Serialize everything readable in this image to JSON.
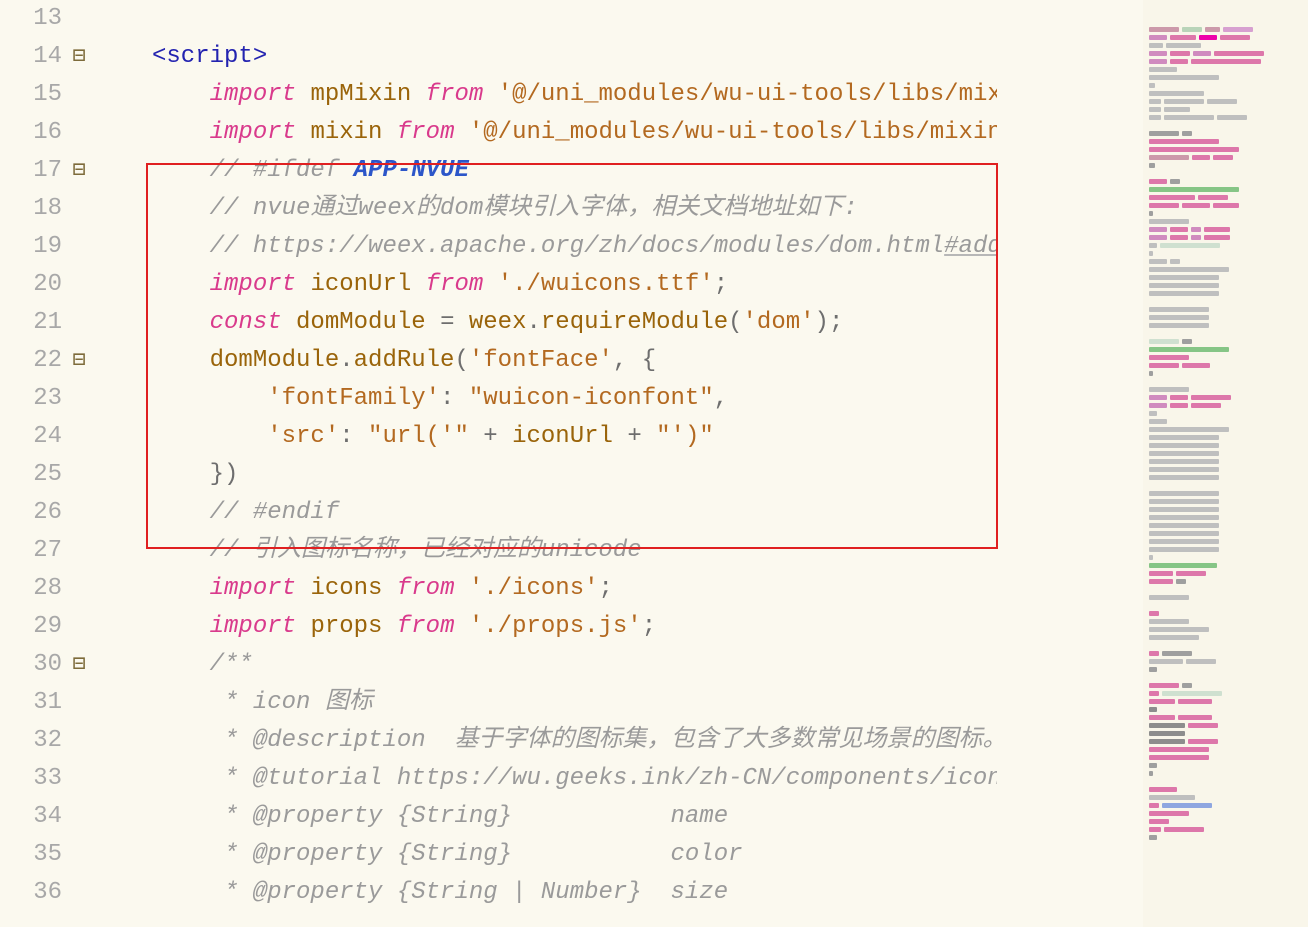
{
  "rows": [
    {
      "n": 13,
      "fold": "",
      "guides": "",
      "html": ""
    },
    {
      "n": 14,
      "fold": "⊟",
      "guides": "",
      "html": "<span class='tag'>&lt;script&gt;</span>"
    },
    {
      "n": 15,
      "fold": "",
      "guides": "a",
      "html": "    <span class='kw-imp'>import</span> <span class='ident'>mpMixin</span> <span class='kw-from'>from</span> <span class='str'>'@/uni_modules/wu-ui-tools/libs/mixin/mpMix</span>"
    },
    {
      "n": 16,
      "fold": "",
      "guides": "a",
      "html": "    <span class='kw-imp'>import</span> <span class='ident'>mixin</span> <span class='kw-from'>from</span> <span class='str'>'@/uni_modules/wu-ui-tools/libs/mixin/mixin.j</span>"
    },
    {
      "n": 17,
      "fold": "⊟",
      "guides": "a",
      "html": "    <span class='comment'>// #ifdef <span class='app'>APP-NVUE</span></span>"
    },
    {
      "n": 18,
      "fold": "",
      "guides": "a",
      "html": "    <span class='comment'>// nvue通过weex的dom模块引入字体，相关文档地址如下:</span>"
    },
    {
      "n": 19,
      "fold": "",
      "guides": "a",
      "html": "    <span class='comment'>// https://weex.apache.org/zh/docs/modules/dom.html<span class='underline-add'>#add</span>rule</span>"
    },
    {
      "n": 20,
      "fold": "",
      "guides": "a",
      "html": "    <span class='kw-imp'>import</span> <span class='ident'>iconUrl</span> <span class='kw-from'>from</span> <span class='str'>'./wuicons.ttf'</span><span class='punct'>;</span>"
    },
    {
      "n": 21,
      "fold": "",
      "guides": "a",
      "html": "    <span class='kw-const'>const</span> <span class='ident'>domModule</span> <span class='punct'>=</span> <span class='ident'>weex</span><span class='punct'>.</span><span class='ident'>requireModule</span><span class='punct'>(</span><span class='str'>'dom'</span><span class='punct'>);</span>"
    },
    {
      "n": 22,
      "fold": "⊟",
      "guides": "a",
      "html": "    <span class='ident'>domModule</span><span class='punct'>.</span><span class='ident'>addRule</span><span class='punct'>(</span><span class='str'>'fontFace'</span><span class='punct'>, {</span>"
    },
    {
      "n": 23,
      "fold": "",
      "guides": "ab",
      "html": "        <span class='str'>'fontFamily'</span><span class='punct'>:</span> <span class='str'>\"wuicon-iconfont\"</span><span class='punct'>,</span>"
    },
    {
      "n": 24,
      "fold": "",
      "guides": "ab",
      "html": "        <span class='str'>'src'</span><span class='punct'>:</span> <span class='str'>\"url('\"</span> <span class='punct'>+</span> <span class='ident'>iconUrl</span> <span class='punct'>+</span> <span class='str'>\"')\"</span>"
    },
    {
      "n": 25,
      "fold": "",
      "guides": "a",
      "html": "    <span class='punct'>})</span>"
    },
    {
      "n": 26,
      "fold": "",
      "guides": "a",
      "html": "    <span class='comment'>// #endif</span>"
    },
    {
      "n": 27,
      "fold": "",
      "guides": "a",
      "html": "    <span class='comment'>// 引入图标名称，已经对应的unicode</span>"
    },
    {
      "n": 28,
      "fold": "",
      "guides": "a",
      "html": "    <span class='kw-imp'>import</span> <span class='ident'>icons</span> <span class='kw-from'>from</span> <span class='str'>'./icons'</span><span class='punct'>;</span>"
    },
    {
      "n": 29,
      "fold": "",
      "guides": "a",
      "html": "    <span class='kw-imp'>import</span> <span class='ident'>props</span> <span class='kw-from'>from</span> <span class='str'>'./props.js'</span><span class='punct'>;</span>"
    },
    {
      "n": 30,
      "fold": "⊟",
      "guides": "a",
      "html": "    <span class='comment'>/**</span>"
    },
    {
      "n": 31,
      "fold": "",
      "guides": "a",
      "html": "    <span class='comment'> * icon 图标</span>"
    },
    {
      "n": 32,
      "fold": "",
      "guides": "a",
      "html": "    <span class='comment'> * @description  基于字体的图标集，包含了大多数常见场景的图标。</span>"
    },
    {
      "n": 33,
      "fold": "",
      "guides": "a",
      "html": "    <span class='comment'> * @tutorial https://wu.geeks.ink/zh-CN/components/icon.html</span>"
    },
    {
      "n": 34,
      "fold": "",
      "guides": "a",
      "html": "    <span class='comment'> * @property {String}           name         <span style='display:inline-block;width:170px'></span>图标名称，若带有</span>"
    },
    {
      "n": 35,
      "fold": "",
      "guides": "a",
      "html": "    <span class='comment'> * @property {String}           color        <span style='display:inline-block;width:170px'></span>图标颜色,可接受主</span>"
    },
    {
      "n": 36,
      "fold": "",
      "guides": "a",
      "html": "    <span class='comment'> * @property {String | Number}  size         <span style='display:inline-block;width:170px'></span>图标字体大小，单</span>"
    }
  ],
  "minimap": [
    [
      [
        30,
        "#c9a"
      ],
      [
        20,
        "#b9d4b9"
      ],
      [
        15,
        "#c9a"
      ],
      [
        30,
        "#d7a0d0"
      ]
    ],
    [
      [
        18,
        "#d08bbf"
      ],
      [
        26,
        "#d7a"
      ],
      [
        18,
        "#e0a"
      ],
      [
        30,
        "#d7a"
      ]
    ],
    [
      [
        14,
        "#bfbfbf"
      ],
      [
        35,
        "#bfbfbf"
      ]
    ],
    [
      [
        18,
        "#d08bbf"
      ],
      [
        20,
        "#d7a"
      ],
      [
        18,
        "#d08bbf"
      ],
      [
        50,
        "#d7a"
      ]
    ],
    [
      [
        18,
        "#d08bbf"
      ],
      [
        18,
        "#d7a"
      ],
      [
        70,
        "#d7a"
      ]
    ],
    [
      [
        28,
        "#bfbfbf"
      ]
    ],
    [
      [
        70,
        "#bfbfbf"
      ]
    ],
    [
      [
        6,
        "#bfbfbf"
      ]
    ],
    [
      [
        55,
        "#bfbfbf"
      ]
    ],
    [
      [
        12,
        "#bfbfbf"
      ],
      [
        40,
        "#bfbfbf"
      ],
      [
        30,
        "#bfbfbf"
      ]
    ],
    [
      [
        12,
        "#bfbfbf"
      ],
      [
        26,
        "#bfbfbf"
      ]
    ],
    [
      [
        12,
        "#bfbfbf"
      ],
      [
        50,
        "#bfbfbf"
      ],
      [
        30,
        "#bfbfbf"
      ]
    ],
    [],
    [
      [
        30,
        "#9f9f9f"
      ],
      [
        10,
        "#9f9f9f"
      ]
    ],
    [
      [
        70,
        "#d7a"
      ]
    ],
    [
      [
        90,
        "#d7a"
      ]
    ],
    [
      [
        40,
        "#c9a"
      ],
      [
        18,
        "#d7a"
      ],
      [
        20,
        "#d7a"
      ]
    ],
    [
      [
        6,
        "#9f9f9f"
      ]
    ],
    [],
    [
      [
        18,
        "#d7a"
      ],
      [
        10,
        "#9f9f9f"
      ]
    ],
    [
      [
        90,
        "#86c586"
      ]
    ],
    [
      [
        46,
        "#d7a"
      ],
      [
        30,
        "#d7a"
      ]
    ],
    [
      [
        30,
        "#d7a"
      ],
      [
        28,
        "#d7a"
      ],
      [
        26,
        "#d7a"
      ]
    ],
    [
      [
        4,
        "#9f9f9f"
      ]
    ],
    [
      [
        40,
        "#bfbfbf"
      ]
    ],
    [
      [
        18,
        "#d08bbf"
      ],
      [
        18,
        "#d7a"
      ],
      [
        10,
        "#d08bbf"
      ],
      [
        26,
        "#d7a"
      ]
    ],
    [
      [
        18,
        "#d08bbf"
      ],
      [
        18,
        "#d7a"
      ],
      [
        10,
        "#d08bbf"
      ],
      [
        26,
        "#d7a"
      ]
    ],
    [
      [
        8,
        "#bfbfbf"
      ],
      [
        60,
        "#cfe0d0"
      ]
    ],
    [
      [
        4,
        "#bfbfbf"
      ]
    ],
    [
      [
        18,
        "#bfbfbf"
      ],
      [
        10,
        "#bfbfbf"
      ]
    ],
    [
      [
        80,
        "#bfbfbf"
      ]
    ],
    [
      [
        70,
        "#bfbfbf"
      ]
    ],
    [
      [
        70,
        "#bfbfbf"
      ]
    ],
    [
      [
        70,
        "#bfbfbf"
      ]
    ],
    [],
    [
      [
        60,
        "#bfbfbf"
      ]
    ],
    [
      [
        60,
        "#bfbfbf"
      ]
    ],
    [
      [
        60,
        "#bfbfbf"
      ]
    ],
    [],
    [
      [
        30,
        "#cfe0d0"
      ],
      [
        10,
        "#9f9f9f"
      ]
    ],
    [
      [
        80,
        "#86c586"
      ]
    ],
    [
      [
        40,
        "#d7a"
      ]
    ],
    [
      [
        30,
        "#d7a"
      ],
      [
        28,
        "#d7a"
      ]
    ],
    [
      [
        4,
        "#9f9f9f"
      ]
    ],
    [],
    [
      [
        40,
        "#bfbfbf"
      ]
    ],
    [
      [
        18,
        "#d08bbf"
      ],
      [
        18,
        "#d7a"
      ],
      [
        40,
        "#d7a"
      ]
    ],
    [
      [
        18,
        "#d08bbf"
      ],
      [
        18,
        "#d7a"
      ],
      [
        30,
        "#d7a"
      ]
    ],
    [
      [
        8,
        "#bfbfbf"
      ]
    ],
    [
      [
        18,
        "#bfbfbf"
      ]
    ],
    [
      [
        80,
        "#bfbfbf"
      ]
    ],
    [
      [
        70,
        "#bfbfbf"
      ]
    ],
    [
      [
        70,
        "#bfbfbf"
      ]
    ],
    [
      [
        70,
        "#bfbfbf"
      ]
    ],
    [
      [
        70,
        "#bfbfbf"
      ]
    ],
    [
      [
        70,
        "#bfbfbf"
      ]
    ],
    [
      [
        70,
        "#bfbfbf"
      ]
    ],
    [],
    [
      [
        70,
        "#bfbfbf"
      ]
    ],
    [
      [
        70,
        "#bfbfbf"
      ]
    ],
    [
      [
        70,
        "#bfbfbf"
      ]
    ],
    [
      [
        70,
        "#bfbfbf"
      ]
    ],
    [
      [
        70,
        "#bfbfbf"
      ]
    ],
    [
      [
        70,
        "#bfbfbf"
      ]
    ],
    [
      [
        70,
        "#bfbfbf"
      ]
    ],
    [
      [
        70,
        "#bfbfbf"
      ]
    ],
    [
      [
        4,
        "#bfbfbf"
      ]
    ],
    [
      [
        68,
        "#86c586"
      ]
    ],
    [
      [
        24,
        "#d7a"
      ],
      [
        30,
        "#d7a"
      ]
    ],
    [
      [
        24,
        "#d7a"
      ],
      [
        10,
        "#9f9f9f"
      ]
    ],
    [],
    [
      [
        40,
        "#bfbfbf"
      ]
    ],
    [],
    [
      [
        10,
        "#d7a"
      ]
    ],
    [
      [
        40,
        "#bfbfbf"
      ]
    ],
    [
      [
        60,
        "#bfbfbf"
      ]
    ],
    [
      [
        50,
        "#bfbfbf"
      ]
    ],
    [],
    [
      [
        10,
        "#d7a"
      ],
      [
        30,
        "#9f9f9f"
      ]
    ],
    [
      [
        34,
        "#bfbfbf"
      ],
      [
        30,
        "#bfbfbf"
      ]
    ],
    [
      [
        8,
        "#9f9f9f"
      ]
    ],
    [],
    [
      [
        30,
        "#d7a"
      ],
      [
        10,
        "#9f9f9f"
      ]
    ],
    [
      [
        10,
        "#d7a"
      ],
      [
        60,
        "#cfe0d0"
      ]
    ],
    [
      [
        26,
        "#d7a"
      ],
      [
        34,
        "#d7a"
      ]
    ],
    [
      [
        8,
        "#8d8d8d"
      ]
    ],
    [
      [
        26,
        "#d7a"
      ],
      [
        34,
        "#d7a"
      ]
    ],
    [
      [
        36,
        "#8d8d8d"
      ],
      [
        30,
        "#d7a"
      ]
    ],
    [
      [
        36,
        "#8d8d8d"
      ]
    ],
    [
      [
        36,
        "#8d8d8d"
      ],
      [
        30,
        "#d7a"
      ]
    ],
    [
      [
        60,
        "#d7a"
      ]
    ],
    [
      [
        60,
        "#d7a"
      ]
    ],
    [
      [
        8,
        "#9f9f9f"
      ]
    ],
    [
      [
        4,
        "#9f9f9f"
      ]
    ],
    [],
    [
      [
        28,
        "#d7a"
      ]
    ],
    [
      [
        46,
        "#bfbfbf"
      ]
    ],
    [
      [
        10,
        "#d7a"
      ],
      [
        50,
        "#8fa6e0"
      ]
    ],
    [
      [
        40,
        "#d7a"
      ]
    ],
    [
      [
        20,
        "#d7a"
      ]
    ],
    [
      [
        12,
        "#d7a"
      ],
      [
        40,
        "#d7a"
      ]
    ],
    [
      [
        8,
        "#9f9f9f"
      ]
    ]
  ]
}
